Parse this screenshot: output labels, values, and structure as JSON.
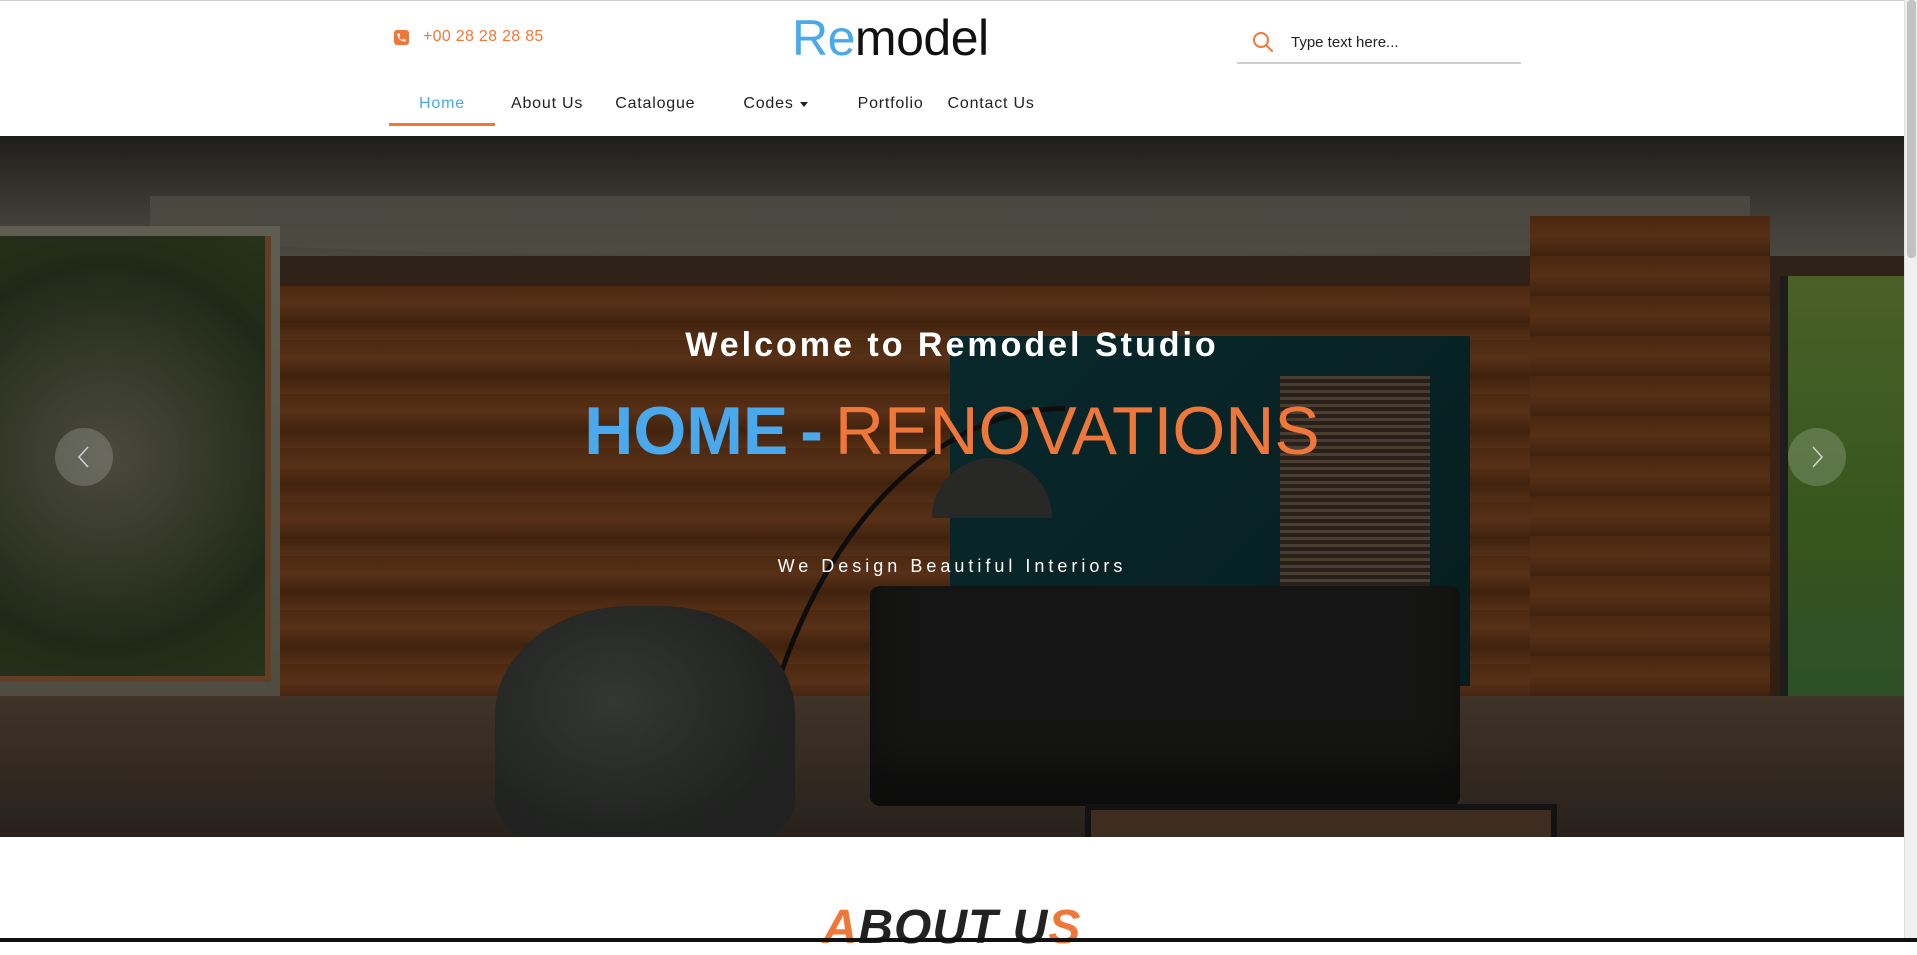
{
  "header": {
    "phone": "+00 28 28 28 85",
    "logo_accent": "Re",
    "logo_rest": "model",
    "search_placeholder": "Type text here..."
  },
  "nav": {
    "items": [
      {
        "label": "Home",
        "active": true
      },
      {
        "label": "About Us"
      },
      {
        "label": "Catalogue"
      },
      {
        "label": "Codes",
        "dropdown": true
      },
      {
        "label": "Portfolio"
      },
      {
        "label": "Contact Us"
      }
    ]
  },
  "hero": {
    "welcome": "Welcome to Remodel Studio",
    "title_home": "HOME",
    "title_dash": "-",
    "title_reno": "RENOVATIONS",
    "subtitle": "We Design Beautiful Interiors"
  },
  "about": {
    "heading_first": "A",
    "heading_mid": "BOUT U",
    "heading_last": "S"
  },
  "colors": {
    "accent_orange": "#f0773a",
    "accent_blue": "#4aa9ec"
  },
  "icons": [
    "phone-icon",
    "search-icon",
    "caret-down-icon",
    "chevron-left-icon",
    "chevron-right-icon"
  ]
}
